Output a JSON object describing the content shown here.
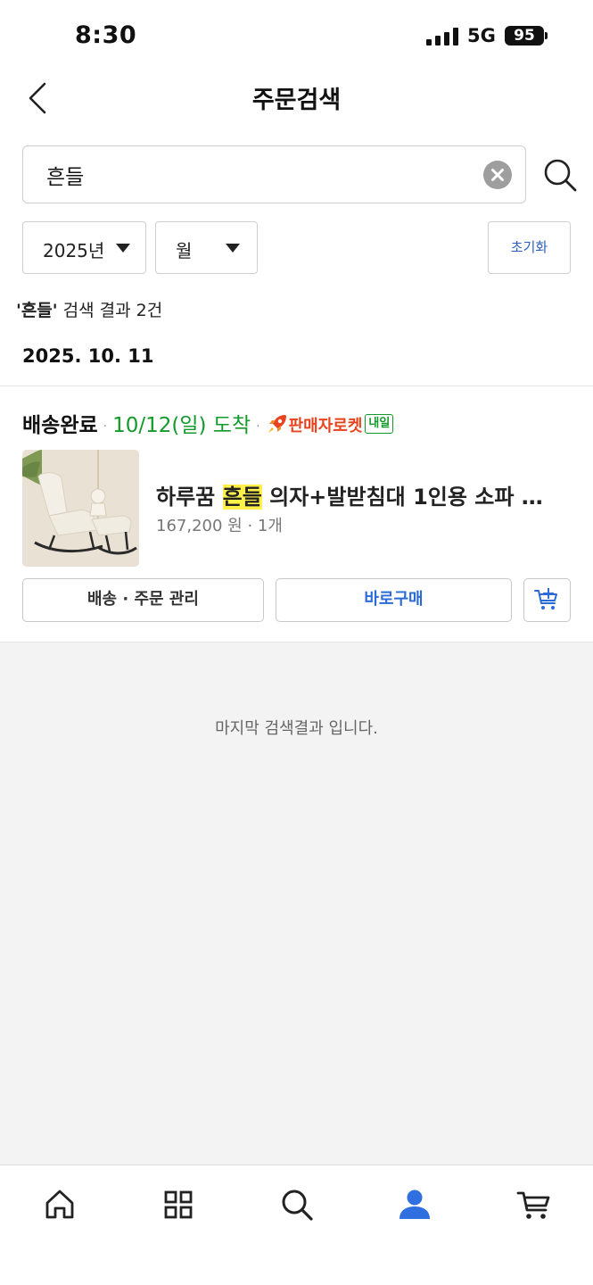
{
  "status_bar": {
    "time": "8:30",
    "network": "5G",
    "battery": "95"
  },
  "header": {
    "title": "주문검색"
  },
  "search": {
    "value": "흔들"
  },
  "filters": {
    "year": "2025년",
    "month": "월",
    "reset_label": "초기화"
  },
  "result": {
    "keyword": "'흔들'",
    "summary": " 검색 결과 2건"
  },
  "orders": [
    {
      "date": "2025. 10. 11",
      "status": "배송완료",
      "arrival": "10/12(일) 도착",
      "delivery_type": "판매자로켓",
      "delivery_badge": "내일",
      "product": {
        "name_prefix": "하루꿈 ",
        "name_highlight": "흔들",
        "name_suffix": " 의자+발받침대 1인용 소파 …",
        "price_qty": "167,200 원 · 1개"
      },
      "buttons": {
        "manage": "배송 · 주문 관리",
        "buy": "바로구매"
      }
    }
  ],
  "end_message": "마지막 검색결과 입니다.",
  "tabbar": [
    "home-icon",
    "category-icon",
    "search-icon",
    "user-icon",
    "cart-icon"
  ],
  "colors": {
    "accent_blue": "#2b6bd8",
    "arrival_green": "#139a2a",
    "rocket_red": "#e8421e",
    "highlight": "#fff14a",
    "active_tab": "#2f6fe0"
  }
}
